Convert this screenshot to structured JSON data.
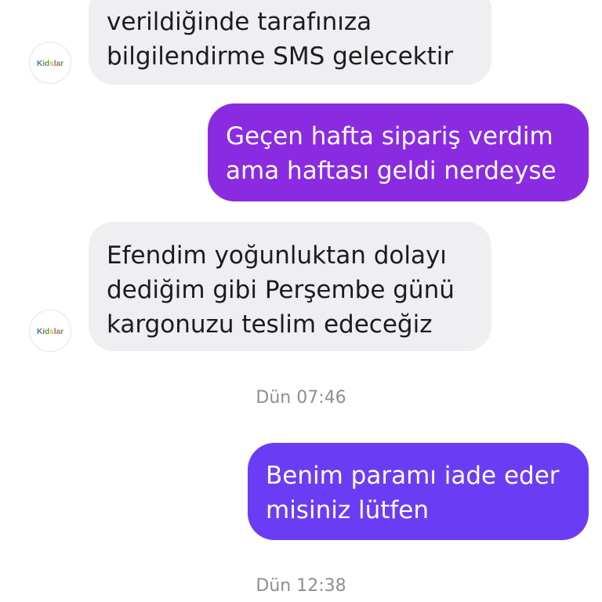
{
  "messages": [
    {
      "direction": "incoming",
      "lines": [
        "verildiğinde tarafınıza",
        "bilgilendirme SMS gelecektir"
      ]
    },
    {
      "direction": "outgoing",
      "lines": [
        "Geçen hafta sipariş verdim",
        "ama haftası geldi nerdeyse"
      ]
    },
    {
      "direction": "incoming",
      "lines": [
        "Efendim yoğunluktan dolayı",
        "dediğim gibi Perşembe günü",
        "kargonuzu teslim edeceğiz"
      ]
    },
    {
      "direction": "outgoing",
      "lines": [
        "Benim paramı iade eder",
        "misiniz lütfen"
      ]
    }
  ],
  "timestamps": [
    "Dün 07:46",
    "Dün 12:38"
  ],
  "avatar": {
    "logo_text": "Kidslar",
    "icon": "kidslar-logo-icon"
  },
  "colors": {
    "incoming_bubble": "#efeff1",
    "outgoing_bubble_1": "#8a2be2",
    "outgoing_bubble_2": "#6a3df5",
    "timestamp_text": "#8e8e93"
  }
}
